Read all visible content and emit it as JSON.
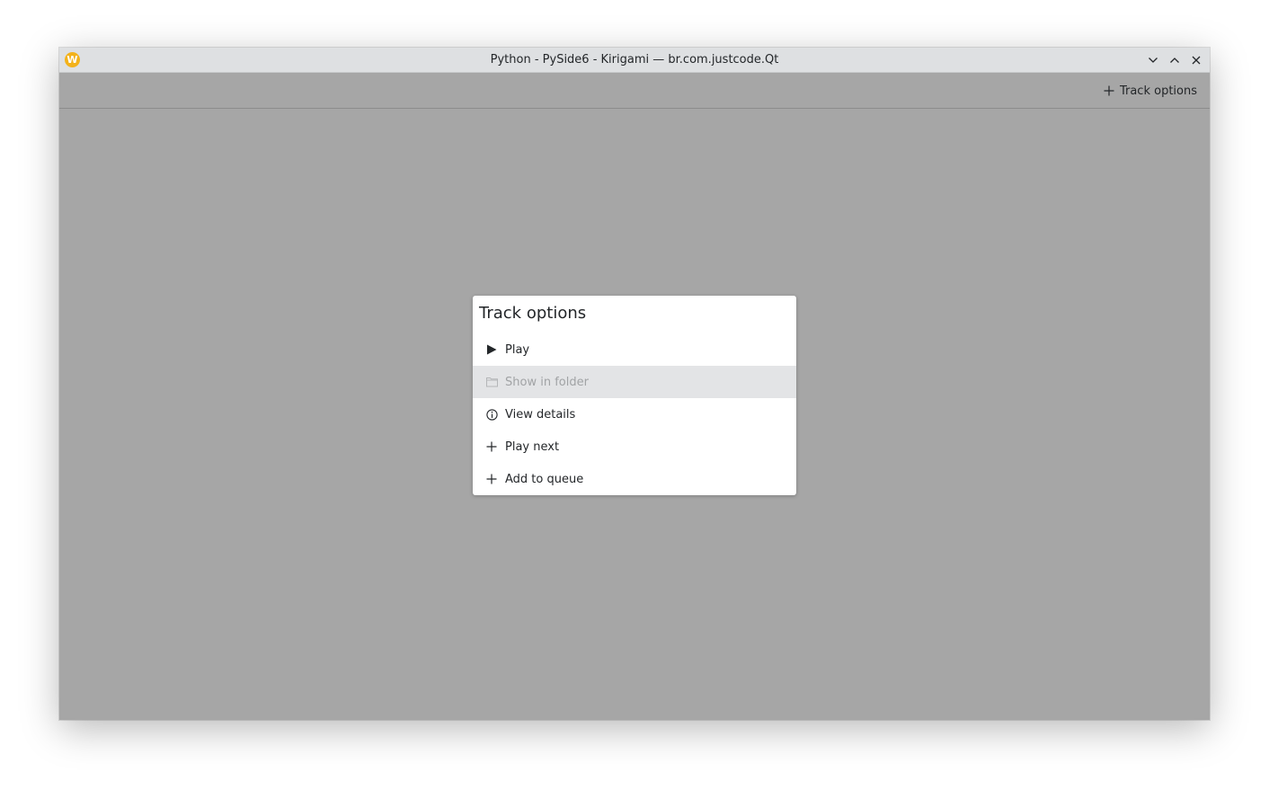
{
  "window": {
    "title": "Python - PySide6 - Kirigami — br.com.justcode.Qt",
    "app_icon_letter": "W"
  },
  "toolbar": {
    "action_label": "Track options"
  },
  "dialog": {
    "title": "Track options",
    "items": [
      {
        "label": "Play",
        "icon": "play-icon",
        "enabled": true
      },
      {
        "label": "Show in folder",
        "icon": "folder-icon",
        "enabled": false
      },
      {
        "label": "View details",
        "icon": "info-icon",
        "enabled": true
      },
      {
        "label": "Play next",
        "icon": "plus-icon",
        "enabled": true
      },
      {
        "label": "Add to queue",
        "icon": "plus-icon",
        "enabled": true
      }
    ]
  },
  "colors": {
    "overlay": "#a6a6a6",
    "titlebar": "#dee0e2",
    "app_icon": "#f3b21a",
    "disabled_item_bg": "#e3e4e6",
    "disabled_text": "#a1a3a5",
    "text": "#232629"
  }
}
